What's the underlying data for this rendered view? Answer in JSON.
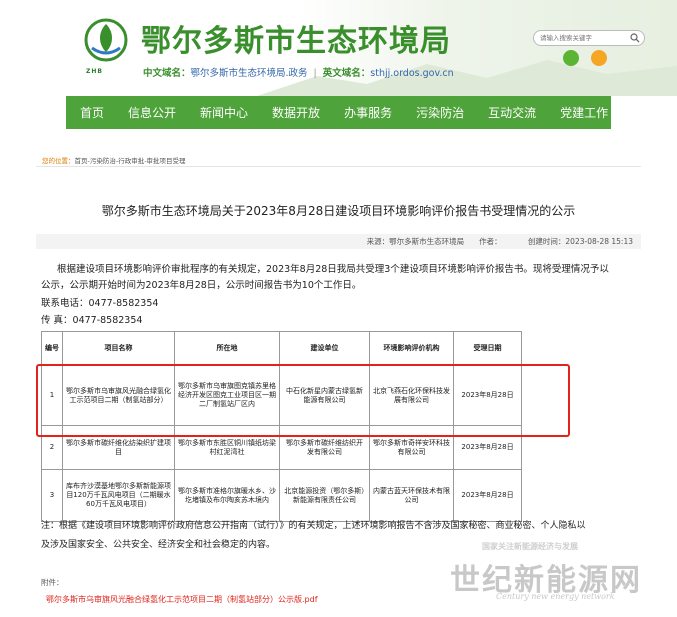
{
  "header": {
    "site_title": "鄂尔多斯市生态环境局",
    "logo_label": "ZHB",
    "cn_domain_label": "中文域名：",
    "cn_domain": "鄂尔多斯市生态环境局.政务",
    "separator": "|",
    "en_domain_label": "英文域名：",
    "en_domain": "sthjj.ordos.gov.cn",
    "search_placeholder": "请输入搜索关键字",
    "colors": {
      "brand_green": "#3a8f2d",
      "nav_green": "#4fa33b"
    }
  },
  "nav": {
    "items": [
      "首页",
      "信息公开",
      "新闻中心",
      "数据开放",
      "办事服务",
      "污染防治",
      "互动交流",
      "党建工作"
    ]
  },
  "breadcrumb": {
    "here": "您的位置：",
    "path": "首页-污染防治-行政审批-审批项目受理"
  },
  "article": {
    "title": "鄂尔多斯市生态环境局关于2023年8月28日建设项目环境影响评价报告书受理情况的公示",
    "meta": "来源：鄂尔多斯市生态环境局　　作者：　　　　创建时间：2023-08-28 15:13",
    "p1": "根据建设项目环境影响评价审批程序的有关规定，2023年8月28日我局共受理3个建设项目环境影响评价报告书。现将受理情况予以",
    "p2": "公示，公示期开始时间为2023年8月28日，公示时间报告书为10个工作日。",
    "p3": "联系电话：0477-8582354",
    "p4": "传 真：0477-8582354",
    "note": "注：根据《建设项目环境影响评价政府信息公开指南（试行）》的有关规定，上述环境影响报告不含涉及国家秘密、商业秘密、个人隐私以",
    "note2": "及涉及国家安全、公共安全、经济安全和社会稳定的内容。",
    "attach_label": "附件：",
    "attach_link": "鄂尔多斯市乌审旗风光融合绿氢化工示范项目二期（制氢站部分）公示版.pdf"
  },
  "table": {
    "headers": [
      "编号",
      "项目名称",
      "所在地",
      "建设单位",
      "环境影响评价机构",
      "受理日期"
    ],
    "rows": [
      [
        "1",
        "鄂尔多斯市乌审旗风光融合绿氢化工示范项目二期（制氢站部分）",
        "鄂尔多斯市乌审旗图克镇苏里格经济开发区图克工业项目区一期二厂制氢站厂区内",
        "中石化新星内蒙古绿氢新能源有限公司",
        "北京飞燕石化环保科技发展有限公司",
        "2023年8月28日"
      ],
      [
        "2",
        "鄂尔多斯市碳纤维化纺染织扩建项目",
        "鄂尔多斯市东胜区铜川镇纸坊梁村红泥湾社",
        "鄂尔多斯市碳纤维纺织开发有限公司",
        "鄂尔多斯市奇祥安环科技有限公司",
        "2023年8月28日"
      ],
      [
        "3",
        "库布齐沙漠基地鄂尔多斯新能源项目120万千瓦风电项目（二期暖水60万千瓦风电项目）",
        "鄂尔多斯市准格尔旗暖水乡、沙圪堵镇及布尔陶亥苏木境内",
        "北京能源投资（鄂尔多斯）新能源有限责任公司",
        "内蒙古蓝天环保技术有限公司",
        "2023年8月28日"
      ]
    ]
  },
  "watermark": {
    "top": "国家关注新能源经济与发展",
    "main": "世纪新能源网",
    "sub": "Century new energy network"
  }
}
